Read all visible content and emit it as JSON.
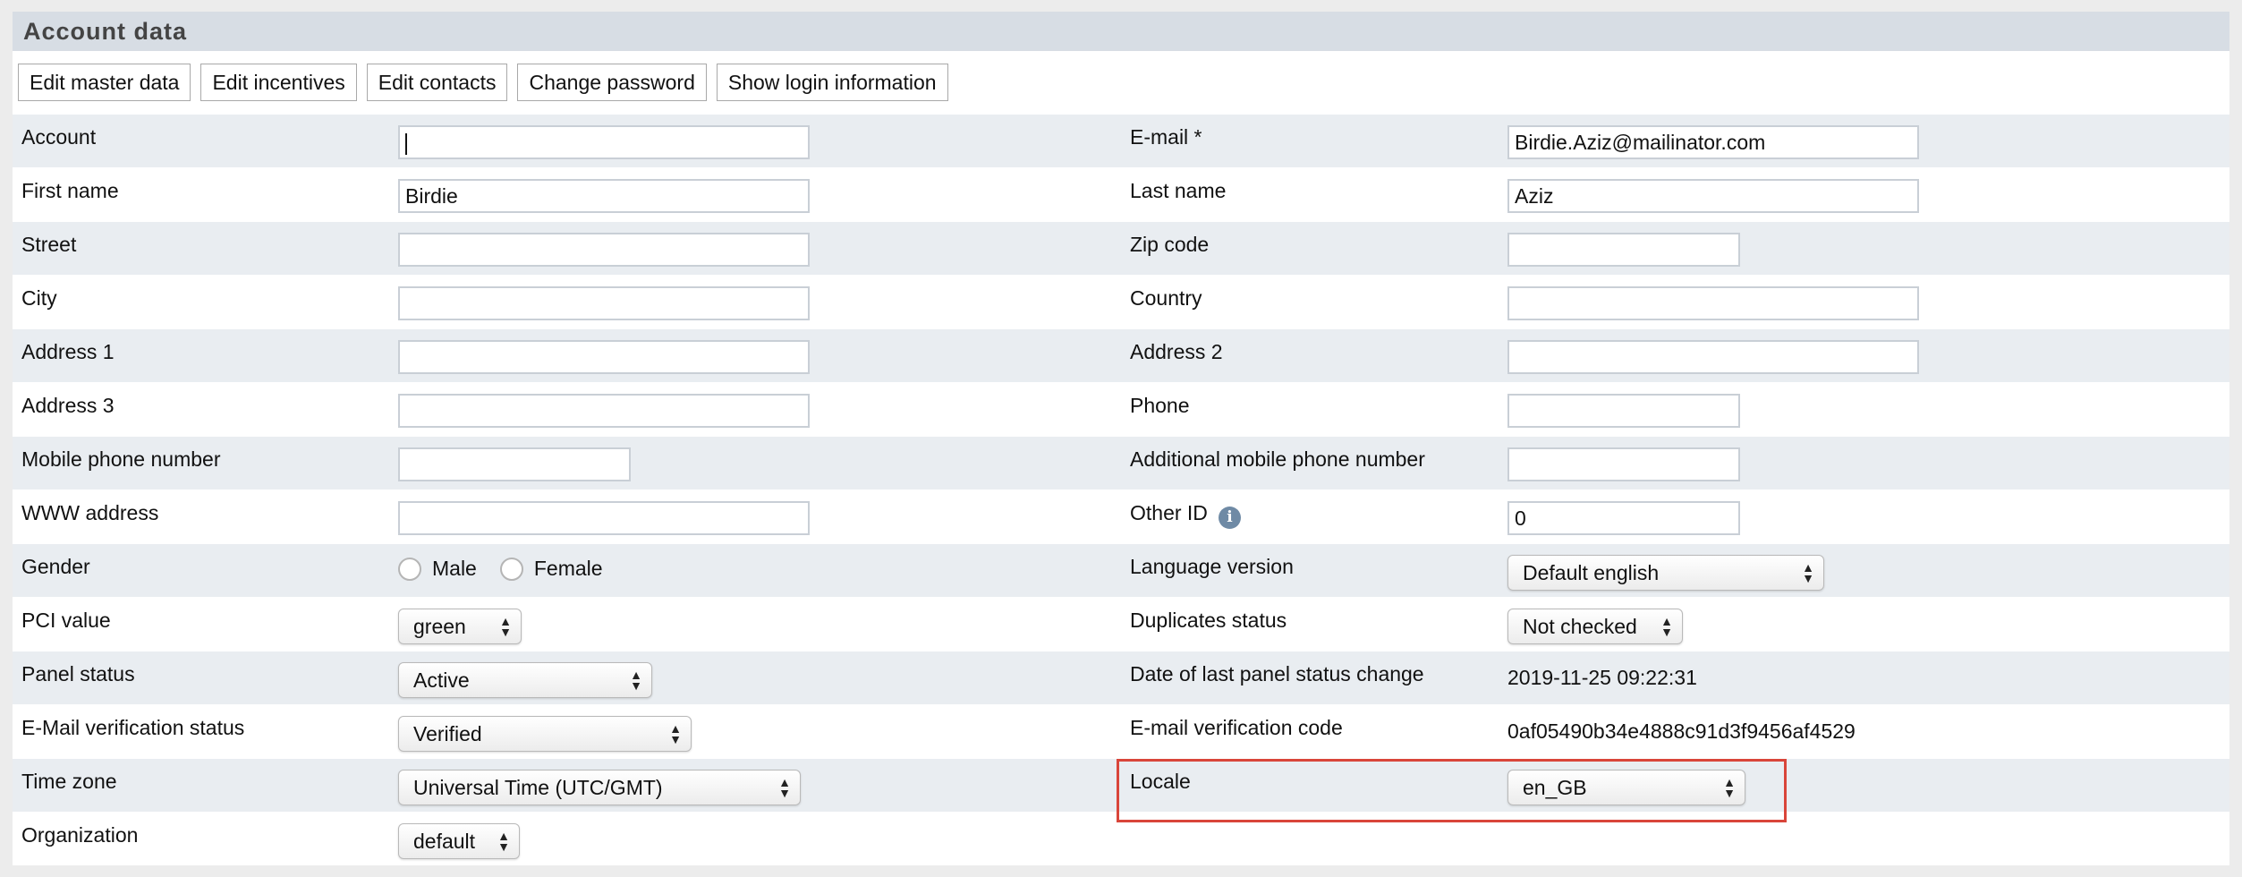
{
  "panel": {
    "title": "Account data"
  },
  "toolbar": {
    "buttons": [
      "Edit master data",
      "Edit incentives",
      "Edit contacts",
      "Change password",
      "Show login information"
    ]
  },
  "fields": {
    "account": {
      "label": "Account",
      "value": ""
    },
    "email": {
      "label": "E-mail *",
      "value": "Birdie.Aziz@mailinator.com"
    },
    "first_name": {
      "label": "First name",
      "value": "Birdie"
    },
    "last_name": {
      "label": "Last name",
      "value": "Aziz"
    },
    "street": {
      "label": "Street",
      "value": ""
    },
    "zip_code": {
      "label": "Zip code",
      "value": ""
    },
    "city": {
      "label": "City",
      "value": ""
    },
    "country": {
      "label": "Country",
      "value": ""
    },
    "address1": {
      "label": "Address 1",
      "value": ""
    },
    "address2": {
      "label": "Address 2",
      "value": ""
    },
    "address3": {
      "label": "Address 3",
      "value": ""
    },
    "phone": {
      "label": "Phone",
      "value": ""
    },
    "mobile_phone": {
      "label": "Mobile phone number",
      "value": ""
    },
    "additional_mobile": {
      "label": "Additional mobile phone number",
      "value": ""
    },
    "www": {
      "label": "WWW address",
      "value": ""
    },
    "other_id": {
      "label": "Other ID",
      "value": "0",
      "info_icon": "info-icon"
    },
    "gender": {
      "label": "Gender",
      "options": [
        "Male",
        "Female"
      ]
    },
    "language_version": {
      "label": "Language version",
      "selected": "Default english"
    },
    "pci_value": {
      "label": "PCI value",
      "selected": "green"
    },
    "duplicates_status": {
      "label": "Duplicates status",
      "selected": "Not checked"
    },
    "panel_status": {
      "label": "Panel status",
      "selected": "Active"
    },
    "last_panel_status_change": {
      "label": "Date of last panel status change",
      "value": "2019-11-25 09:22:31"
    },
    "email_verification_status": {
      "label": "E-Mail verification status",
      "selected": "Verified"
    },
    "email_verification_code": {
      "label": "E-mail verification code",
      "value": "0af05490b34e4888c91d3f9456af4529"
    },
    "time_zone": {
      "label": "Time zone",
      "selected": "Universal Time (UTC/GMT)"
    },
    "locale": {
      "label": "Locale",
      "selected": "en_GB"
    },
    "organization": {
      "label": "Organization",
      "selected": "default"
    }
  },
  "colors": {
    "highlight": "#d9453a",
    "header_bg": "#d7dde4",
    "row_alt": "#e9edf1"
  }
}
